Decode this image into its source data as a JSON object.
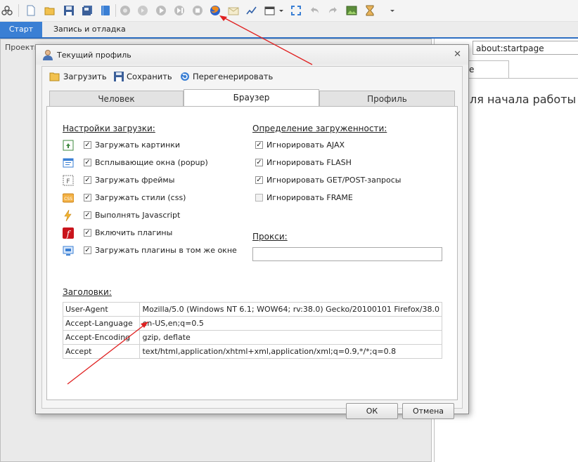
{
  "main_tabs": {
    "start": "Старт",
    "record": "Запись и отладка"
  },
  "projects_panel": {
    "label": "Проекты"
  },
  "browser": {
    "address": "about:startpage",
    "page_tab": "e",
    "start_text": "ля начала работы"
  },
  "dialog": {
    "title": "Текущий профиль",
    "toolbar": {
      "load": "Загрузить",
      "save": "Сохранить",
      "regenerate": "Перегенерировать"
    },
    "tabs": [
      "Человек",
      "Браузер",
      "Профиль"
    ],
    "active_tab": "Браузер",
    "load_settings": {
      "title": "Настройки загрузки:",
      "items": [
        {
          "label": "Загружать картинки",
          "checked": true,
          "icon": "image-icon"
        },
        {
          "label": "Всплывающие окна (popup)",
          "checked": true,
          "icon": "popup-window-icon"
        },
        {
          "label": "Загружать фреймы",
          "checked": true,
          "icon": "frame-icon"
        },
        {
          "label": "Загружать стили (css)",
          "checked": true,
          "icon": "css-icon"
        },
        {
          "label": "Выполнять Javascript",
          "checked": true,
          "icon": "lightning-icon"
        },
        {
          "label": "Включить плагины",
          "checked": true,
          "icon": "flash-icon"
        },
        {
          "label": "Загружать плагины в том же окне",
          "checked": true,
          "icon": "plugin-window-icon"
        }
      ]
    },
    "load_detection": {
      "title": "Определение загруженности:",
      "items": [
        {
          "label": "Игнорировать AJAX",
          "checked": true
        },
        {
          "label": "Игнорировать FLASH",
          "checked": true
        },
        {
          "label": "Игнорировать GET/POST-запросы",
          "checked": true
        },
        {
          "label": "Игнорировать FRAME",
          "checked": false
        }
      ]
    },
    "proxy": {
      "title": "Прокси:",
      "value": ""
    },
    "headers": {
      "title": "Заголовки:",
      "rows": [
        {
          "name": "User-Agent",
          "value": "Mozilla/5.0 (Windows NT 6.1; WOW64; rv:38.0) Gecko/20100101 Firefox/38.0"
        },
        {
          "name": "Accept-Language",
          "value": "en-US,en;q=0.5"
        },
        {
          "name": "Accept-Encoding",
          "value": "gzip, deflate"
        },
        {
          "name": "Accept",
          "value": "text/html,application/xhtml+xml,application/xml;q=0.9,*/*;q=0.8"
        }
      ]
    },
    "buttons": {
      "ok": "ОК",
      "cancel": "Отмена"
    },
    "close_glyph": "✕"
  },
  "colors": {
    "accent": "#3a7fd4",
    "arrow": "#e02020"
  }
}
